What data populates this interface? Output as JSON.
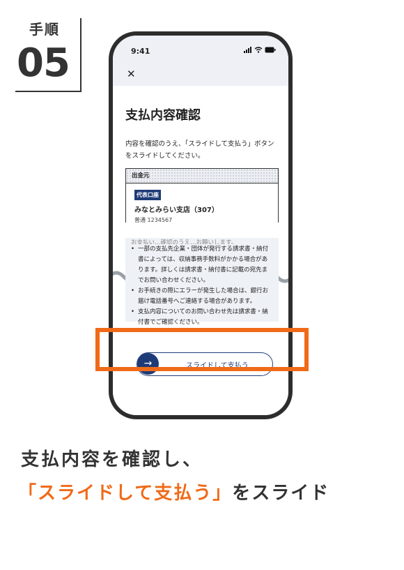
{
  "step": {
    "label": "手順",
    "number": "05"
  },
  "phone": {
    "status": {
      "time": "9:41"
    },
    "header": {
      "close_icon": "close-icon"
    },
    "title": "支払内容確認",
    "description": "内容を確認のうえ、「スライドして支払う」ボタンをスライドしてください。",
    "card": {
      "header": "出金元",
      "badge": "代表口座",
      "branch": "みなとみらい支店（307）",
      "account": "普通 1234567"
    },
    "notes": {
      "partial_line": "お支払い…確認のうえ…お願いします。",
      "items": [
        "一部の支払先企業・団体が発行する請求書・納付書によっては、収納事務手数料がかかる場合があります。詳しくは請求書・納付書に記載の宛先までお問い合わせください。",
        "お手続きの際にエラーが発生した場合は、銀行お届け電話番号へご連絡する場合があります。",
        "支払内容についてのお問い合わせ先は請求書・納付書でご確認ください。"
      ]
    },
    "slider": {
      "label": "スライドして支払う",
      "icon": "arrow-right-icon"
    }
  },
  "caption": {
    "line1": "支払内容を確認し、",
    "line2_emphasis": "「スライドして支払う」",
    "line2_rest": "をスライド"
  },
  "colors": {
    "accent": "#f06a18",
    "brand_navy": "#1f3b77",
    "panel_bg": "#eef1f6"
  }
}
